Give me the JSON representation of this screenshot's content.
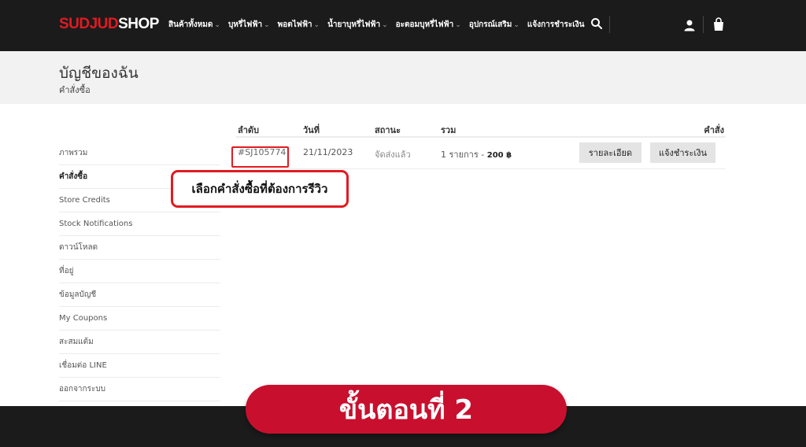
{
  "header": {
    "logo_part1": "SUDJUD",
    "logo_part2": "SHOP",
    "nav": [
      {
        "label": "สินค้าทั้งหมด",
        "has_dropdown": true
      },
      {
        "label": "บุหรี่ไฟฟ้า",
        "has_dropdown": true
      },
      {
        "label": "พอตไฟฟ้า",
        "has_dropdown": true
      },
      {
        "label": "น้ำยาบุหรี่ไฟฟ้า",
        "has_dropdown": true
      },
      {
        "label": "อะตอมบุหรี่ไฟฟ้า",
        "has_dropdown": true
      },
      {
        "label": "อุปกรณ์เสริม",
        "has_dropdown": true
      },
      {
        "label": "แจ้งการชำระเงิน",
        "has_dropdown": false
      }
    ],
    "icons": [
      "search-icon",
      "user-icon",
      "cart-icon"
    ]
  },
  "page": {
    "title": "บัญชีของฉัน",
    "breadcrumb": "คำสั่งซื้อ"
  },
  "sidebar": {
    "items": [
      {
        "label": "ภาพรวม",
        "active": false
      },
      {
        "label": "คำสั่งซื้อ",
        "active": true
      },
      {
        "label": "Store Credits",
        "active": false
      },
      {
        "label": "Stock Notifications",
        "active": false
      },
      {
        "label": "ดาวน์โหลด",
        "active": false
      },
      {
        "label": "ที่อยู่",
        "active": false
      },
      {
        "label": "ข้อมูลบัญชี",
        "active": false
      },
      {
        "label": "My Coupons",
        "active": false
      },
      {
        "label": "สะสมแต้ม",
        "active": false
      },
      {
        "label": "เชื่อมต่อ LINE",
        "active": false
      },
      {
        "label": "ออกจากระบบ",
        "active": false
      }
    ]
  },
  "orders": {
    "headers": {
      "number": "ลำดับ",
      "date": "วันที่",
      "status": "สถานะ",
      "total": "รวม",
      "actions": "คำสั่ง"
    },
    "rows": [
      {
        "number": "#SJ105774",
        "date": "21/11/2023",
        "status": "จัดส่งแล้ว",
        "items": "1 รายการ -",
        "price": "200 ฿",
        "view_button": "รายละเอียด",
        "pay_button": "แจ้งชำระเงิน"
      }
    ]
  },
  "annotation": {
    "callout": "เลือกคำสั่งซื้อที่ต้องการรีวิว",
    "step_label": "ขั้นตอนที่ 2",
    "accent_color": "#e11b22",
    "banner_color": "#c8102e"
  }
}
